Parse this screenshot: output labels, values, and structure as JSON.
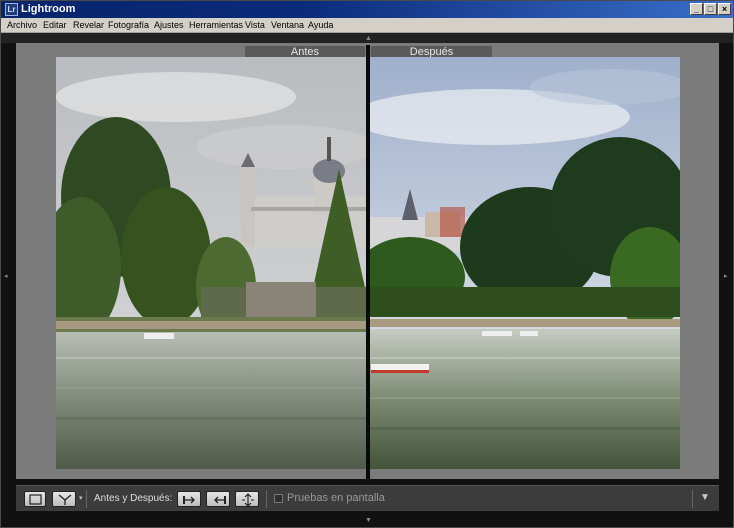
{
  "window": {
    "title": "Lightroom",
    "icon_text": "Lr",
    "icon": "lightroom-app-icon"
  },
  "window_controls": {
    "minimize": "_",
    "maximize": "□",
    "close": "×"
  },
  "menu": [
    "Archivo",
    "Editar",
    "Revelar",
    "Fotografía",
    "Ajustes",
    "Herramientas",
    "Vista",
    "Ventana",
    "Ayuda"
  ],
  "compare": {
    "before_label": "Antes",
    "after_label": "Después"
  },
  "toolbar": {
    "view_mode_icon": "loupe-view-icon",
    "before_after_icon": "before-after-split-icon",
    "before_after_label": "Antes y Después:",
    "copy_before_to_after_icon": "arrow-right-icon",
    "copy_after_to_before_icon": "arrow-left-icon",
    "swap_icon": "swap-vertical-icon",
    "soft_proofing_label": "Pruebas en pantalla",
    "soft_proofing_checked": false,
    "menu_icon": "triangle-down-icon"
  },
  "colors": {
    "titlebar": "#0a2a7a",
    "stage": "#7b7b7b",
    "toolbar": "#3c3c3c"
  }
}
